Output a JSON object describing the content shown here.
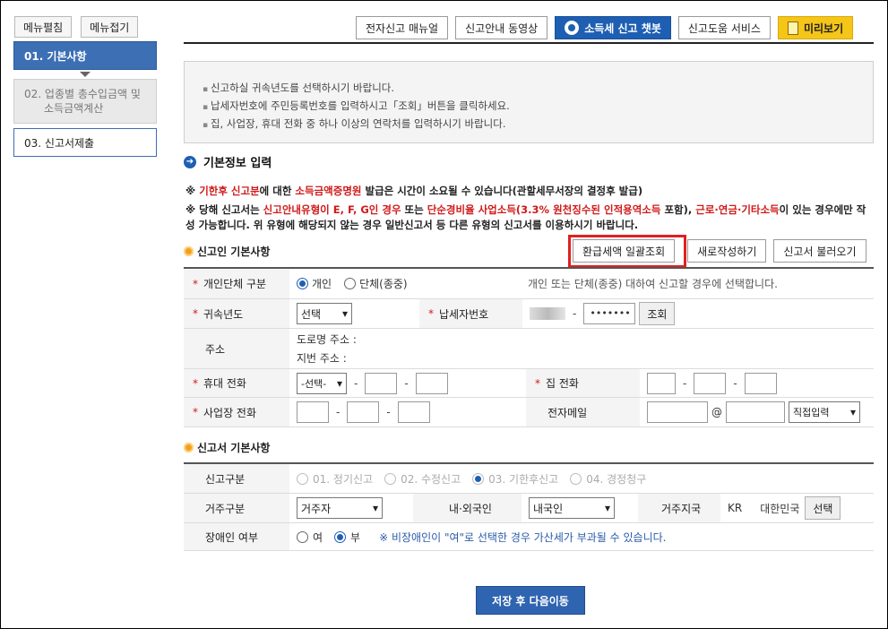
{
  "sidebar": {
    "expand_label": "메뉴펼침",
    "collapse_label": "메뉴접기",
    "steps": [
      {
        "label": "01. 기본사항"
      },
      {
        "label_line1": "02. 업종별 총수입금액 및",
        "label_line2": "소득금액계산"
      },
      {
        "label": "03. 신고서제출"
      }
    ]
  },
  "toolbar": {
    "manual": "전자신고 매뉴얼",
    "video": "신고안내 동영상",
    "chatbot": "소득세 신고 챗봇",
    "help": "신고도움 서비스",
    "preview": "미리보기"
  },
  "notice": [
    "신고하실 귀속년도를 선택하시기 바랍니다.",
    "납세자번호에 주민등록번호를 입력하시고「조회」버튼을 클릭하세요.",
    "집, 사업장, 휴대 전화 중 하나 이상의 연락처를 입력하시기 바랍니다."
  ],
  "section_title": "기본정보 입력",
  "warnings": {
    "w1_prefix": "※ ",
    "w1_red1": "기한후 신고분",
    "w1_mid": "에 대한 ",
    "w1_red2": "소득금액증명원",
    "w1_suffix": " 발급은 시간이 소요될 수 있습니다(관할세무서장의 결정후 발급)",
    "w2_prefix": "※ 당해 신고서는 ",
    "w2_red1": "신고안내유형이 E, F, G인 경우",
    "w2_mid1": " 또는 ",
    "w2_red2": "단순경비율 사업소득(3.3% 원천징수된 인적용역소득",
    "w2_mid2": " 포함), ",
    "w2_red3": "근로·연금·기타소득",
    "w2_suffix": "이 있는 경우에만 작성 가능합니다. 위 유형에 해당되지 않는 경우 일반신고서 등 다른 유형의 신고서를 이용하시기 바랍니다."
  },
  "filer_section": {
    "title": "신고인 기본사항",
    "buttons": {
      "refund": "환급세액 일괄조회",
      "new": "새로작성하기",
      "load": "신고서 불러오기"
    },
    "rows": {
      "type_label": "개인단체 구분",
      "type_opt1": "개인",
      "type_opt2": "단체(종중)",
      "type_note": "개인 또는 단체(종중) 대하여 신고할 경우에 선택합니다.",
      "year_label": "귀속년도",
      "year_value": "선택",
      "taxid_label": "납세자번호",
      "taxid_masked": "•••••••",
      "lookup": "조회",
      "addr_label": "주소",
      "road_addr": "도로명 주소 :",
      "lot_addr": "지번 주소 :",
      "mobile_label": "휴대 전화",
      "mobile_select": "-선택-",
      "home_label": "집 전화",
      "biz_label": "사업장 전화",
      "email_label": "전자메일",
      "at": "@",
      "email_domain": "직접입력"
    }
  },
  "return_section": {
    "title": "신고서 기본사항",
    "kind_label": "신고구분",
    "kinds": [
      "01. 정기신고",
      "02. 수정신고",
      "03. 기한후신고",
      "04. 경정청구"
    ],
    "residency_label": "거주구분",
    "residency_value": "거주자",
    "nationality_label": "내·외국인",
    "nationality_value": "내국인",
    "country_label": "거주지국",
    "country_code": "KR",
    "country_name": "대한민국",
    "country_select": "선택",
    "disabled_label": "장애인 여부",
    "disabled_yes": "여",
    "disabled_no": "부",
    "disabled_note": "※ 비장애인이 \"여\"로 선택한 경우 가산세가 부과될 수 있습니다."
  },
  "save_button": "저장 후 다음이동"
}
